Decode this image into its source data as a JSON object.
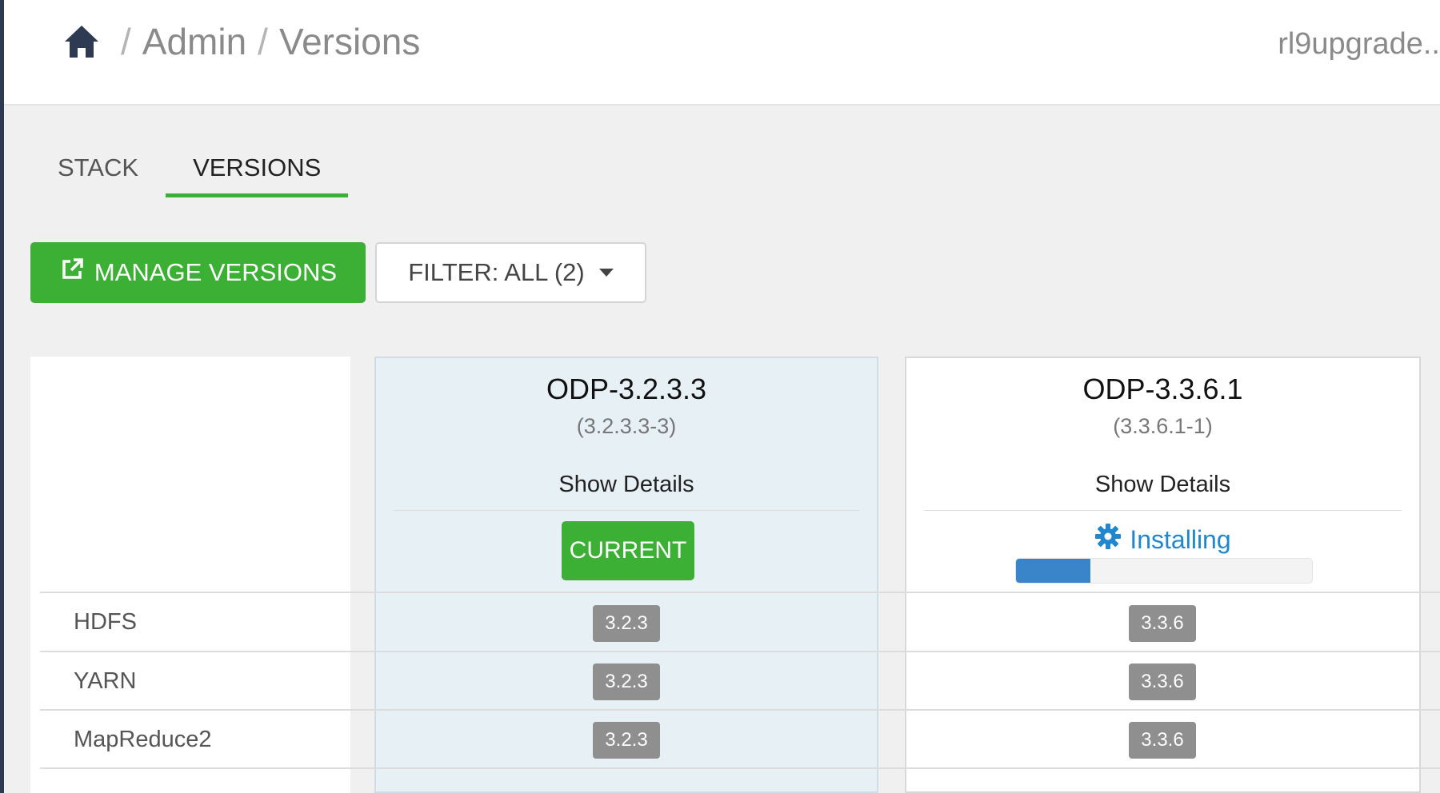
{
  "breadcrumb": {
    "items": [
      "Admin",
      "Versions"
    ],
    "separator": "/"
  },
  "header": {
    "host": "rl9upgrade.."
  },
  "tabs": [
    {
      "label": "STACK",
      "active": false
    },
    {
      "label": "VERSIONS",
      "active": true
    }
  ],
  "toolbar": {
    "manage_label": "MANAGE VERSIONS",
    "filter_label": "FILTER: ALL (2)"
  },
  "versions": [
    {
      "name": "ODP-3.2.3.3",
      "build": "(3.2.3.3-3)",
      "details": "Show Details",
      "status": "CURRENT"
    },
    {
      "name": "ODP-3.3.6.1",
      "build": "(3.3.6.1-1)",
      "details": "Show Details",
      "status": "Installing",
      "progress_percent": 25
    }
  ],
  "services": [
    {
      "name": "HDFS",
      "versions": [
        "3.2.3",
        "3.3.6"
      ]
    },
    {
      "name": "YARN",
      "versions": [
        "3.2.3",
        "3.3.6"
      ]
    },
    {
      "name": "MapReduce2",
      "versions": [
        "3.2.3",
        "3.3.6"
      ]
    }
  ],
  "colors": {
    "accent_green": "#3cb034",
    "installing_blue": "#1f87cf",
    "current_col_bg": "#e6f0f5",
    "progress_fill": "#3a85c9"
  }
}
